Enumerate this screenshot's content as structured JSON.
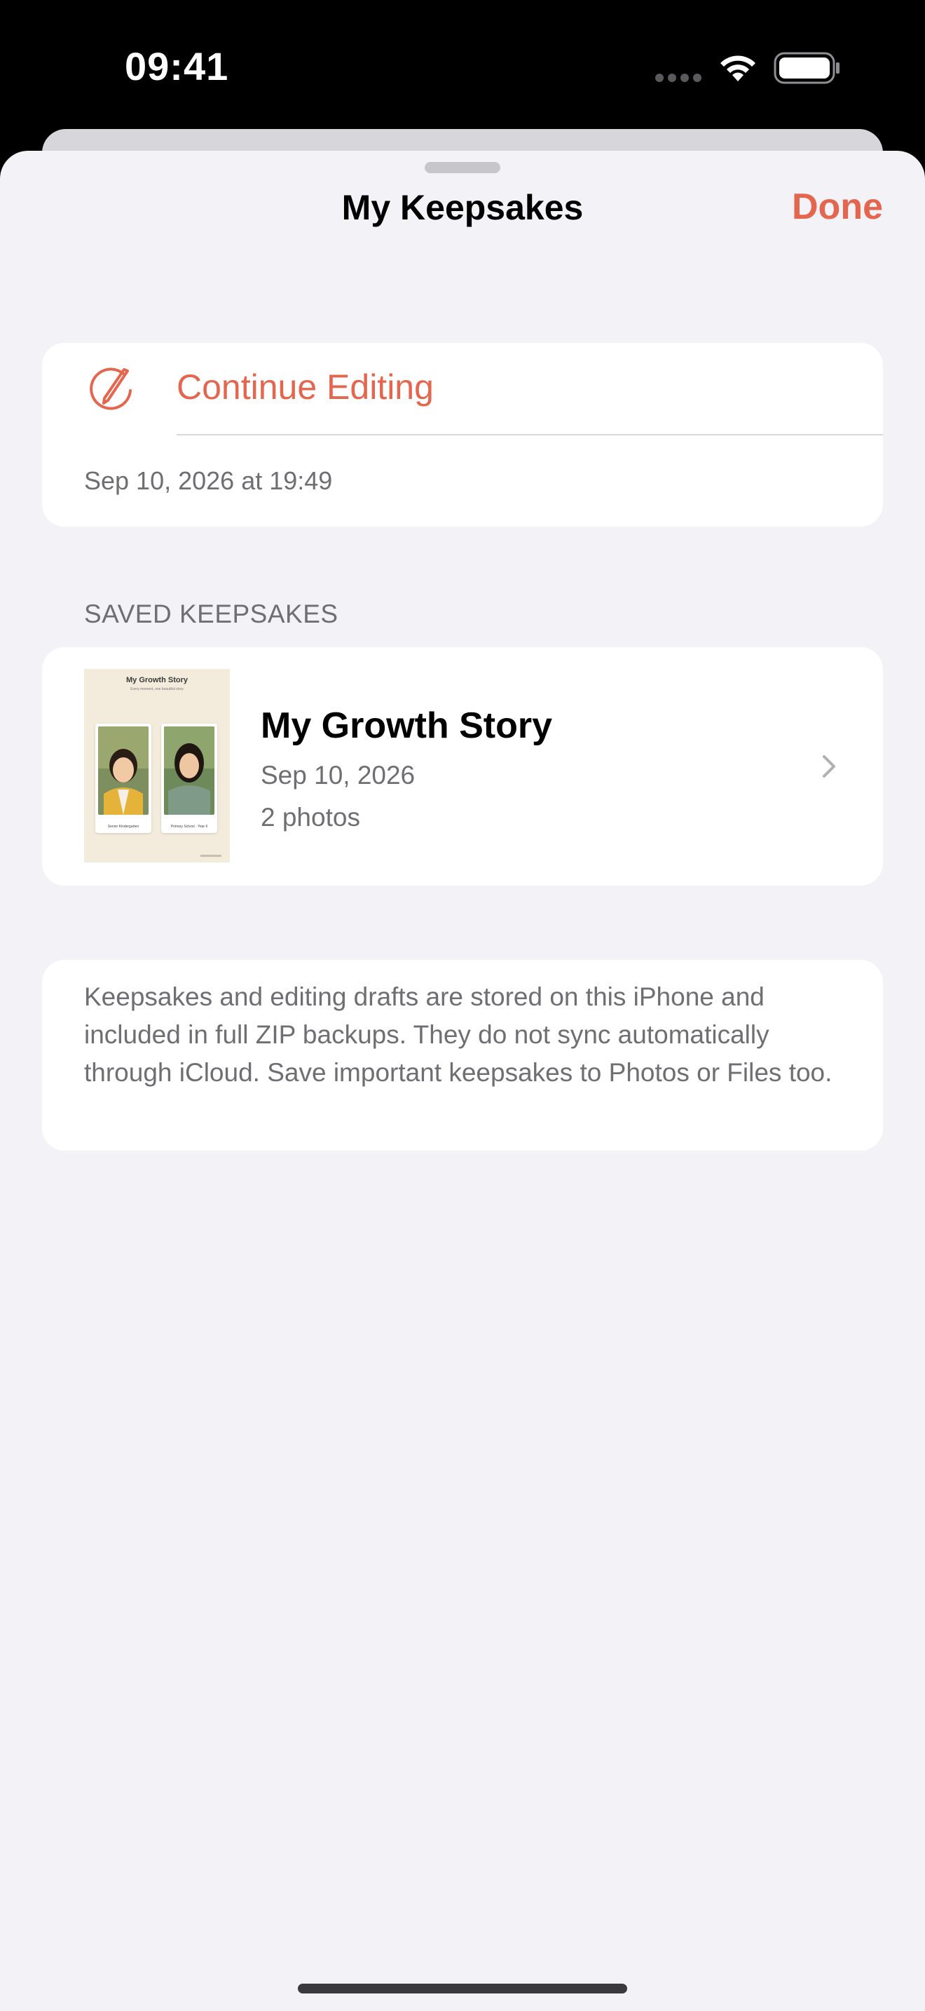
{
  "status_bar": {
    "time": "09:41",
    "icons": [
      "cellular-signal-icon",
      "wifi-icon",
      "battery-icon"
    ]
  },
  "sheet": {
    "title": "My Keepsakes",
    "done_label": "Done"
  },
  "continue_editing": {
    "label": "Continue Editing",
    "icon": "pencil-circle-icon",
    "date": "Sep 10, 2026 at 19:49"
  },
  "saved_section": {
    "header": "SAVED KEEPSAKES",
    "items": [
      {
        "title": "My Growth Story",
        "date": "Sep 10, 2026",
        "count": "2 photos",
        "thumbnail": {
          "title": "My Growth Story",
          "subtitle": "Every moment, one beautiful story",
          "photos": [
            {
              "caption": "Senior Kindergarten"
            },
            {
              "caption": "Primary School · Year 6"
            }
          ]
        }
      }
    ]
  },
  "info": {
    "text": "Keepsakes and editing drafts are stored on this iPhone and included in full ZIP backups. They do not sync automatically through iCloud. Save important keepsakes to Photos or Files too."
  },
  "colors": {
    "accent": "#e5664e",
    "background": "#f2f2f7",
    "card": "#ffffff",
    "secondary_text": "#6e6e73"
  }
}
